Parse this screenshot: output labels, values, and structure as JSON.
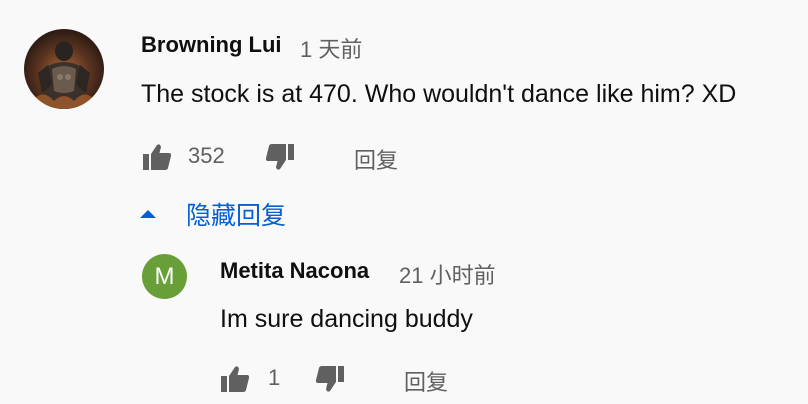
{
  "comment": {
    "author": "Browning Lui",
    "time": "1 天前",
    "text": "The stock is at 470. Who wouldn't dance like him? XD",
    "likes": "352",
    "reply_label": "回复",
    "avatar_icon": "warrior-avatar-image"
  },
  "replies_toggle": {
    "label": "隐藏回复",
    "icon": "caret-up-icon",
    "color": "#065fd4"
  },
  "reply": {
    "author": "Metita Nacona",
    "time": "21 小时前",
    "text": "Im sure dancing buddy",
    "likes": "1",
    "reply_label": "回复",
    "avatar_letter": "M",
    "avatar_color": "#689f38"
  }
}
